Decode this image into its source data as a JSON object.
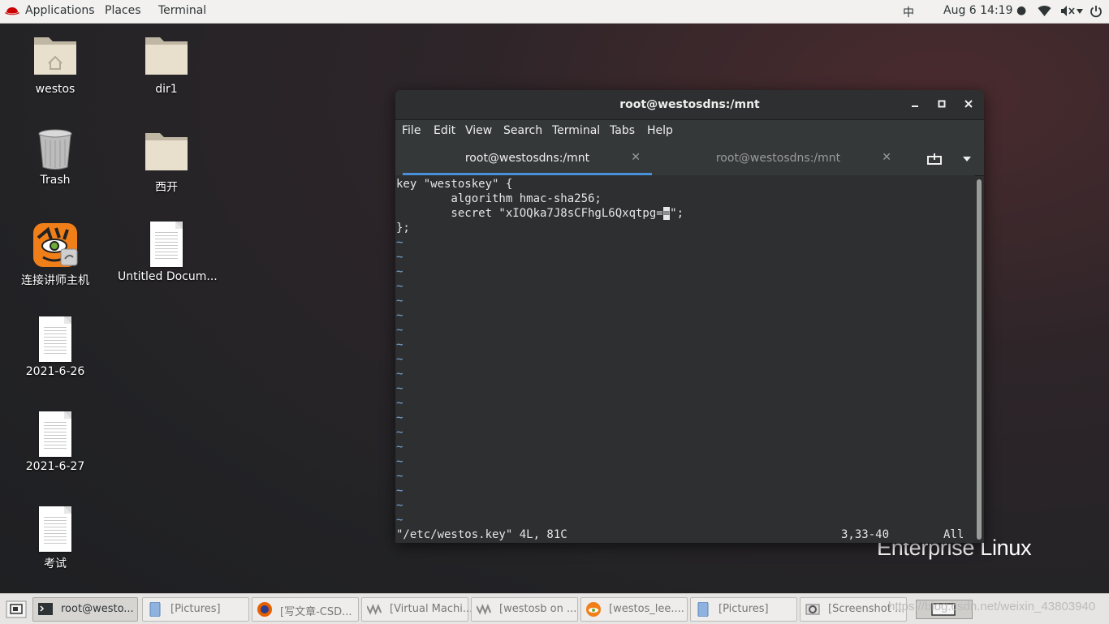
{
  "topbar": {
    "applications": "Applications",
    "places": "Places",
    "terminal": "Terminal",
    "input_method": "中",
    "clock": "Aug 6  14:19 ●"
  },
  "desktop": {
    "icons": [
      {
        "label": "westos"
      },
      {
        "label": "dir1"
      },
      {
        "label": "Trash"
      },
      {
        "label": "西开"
      },
      {
        "label": "连接讲师主机"
      },
      {
        "label": "Untitled Docum..."
      },
      {
        "label": "2021-6-26"
      },
      {
        "label": "2021-6-27"
      },
      {
        "label": "考试"
      }
    ],
    "brand": "Enterprise Linux"
  },
  "terminal": {
    "title": "root@westosdns:/mnt",
    "menu": [
      "File",
      "Edit",
      "View",
      "Search",
      "Terminal",
      "Tabs",
      "Help"
    ],
    "tabs": [
      {
        "label": "root@westosdns:/mnt",
        "active": true
      },
      {
        "label": "root@westosdns:/mnt",
        "active": false
      }
    ],
    "lines": [
      "key \"westoskey\" {",
      "        algorithm hmac-sha256;",
      "        secret \"xIOQka7J8sCFhgL6Qxqtpg=",
      "};"
    ],
    "cursor_char": "=",
    "line3_tail": "\";",
    "tilde": "~",
    "tilde_count": 20,
    "status_file": "\"/etc/westos.key\" 4L, 81C",
    "status_pos": "3,33-40",
    "status_all": "All"
  },
  "taskbar": {
    "items": [
      {
        "label": "root@westo...",
        "icon": "terminal-icon"
      },
      {
        "label": "[Pictures]",
        "icon": "file-manager-icon"
      },
      {
        "label": "[写文章-CSD...",
        "icon": "firefox-icon"
      },
      {
        "label": "[Virtual Machi...",
        "icon": "virt-manager-icon"
      },
      {
        "label": "[westosb on ...",
        "icon": "virt-manager-icon"
      },
      {
        "label": "[westos_lee....",
        "icon": "vncviewer-icon"
      },
      {
        "label": "[Pictures]",
        "icon": "file-manager-icon"
      },
      {
        "label": "[Screenshot ...",
        "icon": "screenshot-icon"
      }
    ],
    "watermark": "https://blog.csdn.net/weixin_43803940"
  },
  "colors": {
    "accent": "#4a90d9",
    "terminal_bg": "#2d2f30"
  }
}
